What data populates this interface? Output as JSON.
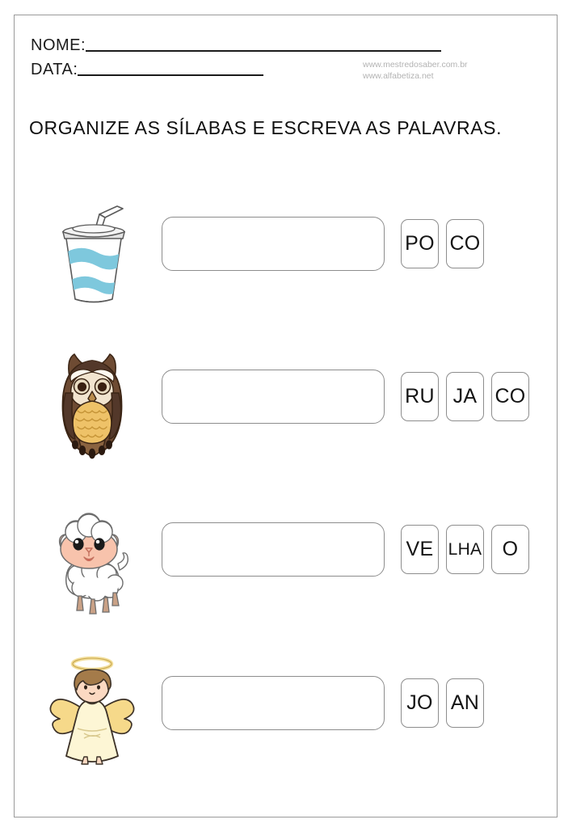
{
  "page": {
    "title": "ORGANIZE AS SÍLABAS E ESCREVA AS PALAVRAS.",
    "border_color": "#9a9a9a",
    "background": "#ffffff"
  },
  "header": {
    "name_label": "NOME:",
    "date_label": "DATA:",
    "websites": [
      "www.mestredosaber.com.br",
      "www.alfabetiza.net"
    ],
    "website_color": "#b3b3b3",
    "rule_color": "#1b1b1b"
  },
  "exercises": [
    {
      "picture": "cup-icon",
      "picture_label": "paper cup with straw",
      "answer_value": "",
      "answer_placeholder": "",
      "syllables": [
        "PO",
        "CO"
      ],
      "colors": {
        "cup_stripe": "#7ec8dd",
        "cup_body": "#ffffff",
        "lid": "#eeeeee",
        "outline": "#5a5a5a"
      }
    },
    {
      "picture": "owl-icon",
      "picture_label": "brown owl",
      "answer_value": "",
      "answer_placeholder": "",
      "syllables": [
        "RU",
        "JA",
        "CO"
      ],
      "colors": {
        "body": "#6e4b33",
        "body_dark": "#4a3020",
        "belly": "#eec268",
        "face": "#f2e4cf",
        "eye": "#3a2012",
        "outline": "#3a2414"
      }
    },
    {
      "picture": "sheep-icon",
      "picture_label": "white sheep",
      "answer_value": "",
      "answer_placeholder": "",
      "syllables": [
        "VE",
        "LHA",
        "O"
      ],
      "colors": {
        "wool": "#ffffff",
        "face": "#f8c3ac",
        "hoof": "#c9a186",
        "eye": "#1a1a1a",
        "outline": "#6d6d6d"
      }
    },
    {
      "picture": "angel-icon",
      "picture_label": "angel with halo and wings",
      "answer_value": "",
      "answer_placeholder": "",
      "syllables": [
        "JO",
        "AN"
      ],
      "colors": {
        "robe": "#fdf6d5",
        "wing": "#f6d98a",
        "halo": "#f3df9c",
        "hair": "#a47b4a",
        "skin": "#fbd9c2",
        "outline": "#3d3228"
      }
    }
  ],
  "tile_style": {
    "border_color": "#8d8d8d",
    "text_color": "#141414"
  }
}
